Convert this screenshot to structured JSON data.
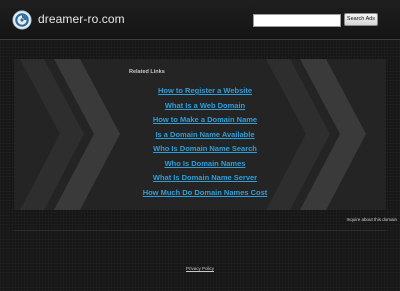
{
  "header": {
    "site_name": "dreamer-ro.com",
    "search": {
      "value": "",
      "placeholder": "",
      "button_label": "Search Ads"
    }
  },
  "main": {
    "related_title": "Related Links",
    "links": [
      {
        "label": "How to Register a Website"
      },
      {
        "label": "What Is a Web Domain"
      },
      {
        "label": "How to Make a Domain Name"
      },
      {
        "label": "Is a Domain Name Available"
      },
      {
        "label": "Who Is Domain Name Search"
      },
      {
        "label": "Who Is Domain Names"
      },
      {
        "label": "What Is Domain Name Server"
      },
      {
        "label": "How Much Do Domain Names Cost"
      }
    ]
  },
  "footer": {
    "inquire_label": "Inquire about this domain",
    "privacy_label": "Privacy Policy"
  },
  "colors": {
    "background": "#161616",
    "panel": "#242424",
    "link": "#2d9fd8",
    "header_text": "#e8e8e8"
  },
  "icons": {
    "logo": "circular-logo-icon"
  }
}
